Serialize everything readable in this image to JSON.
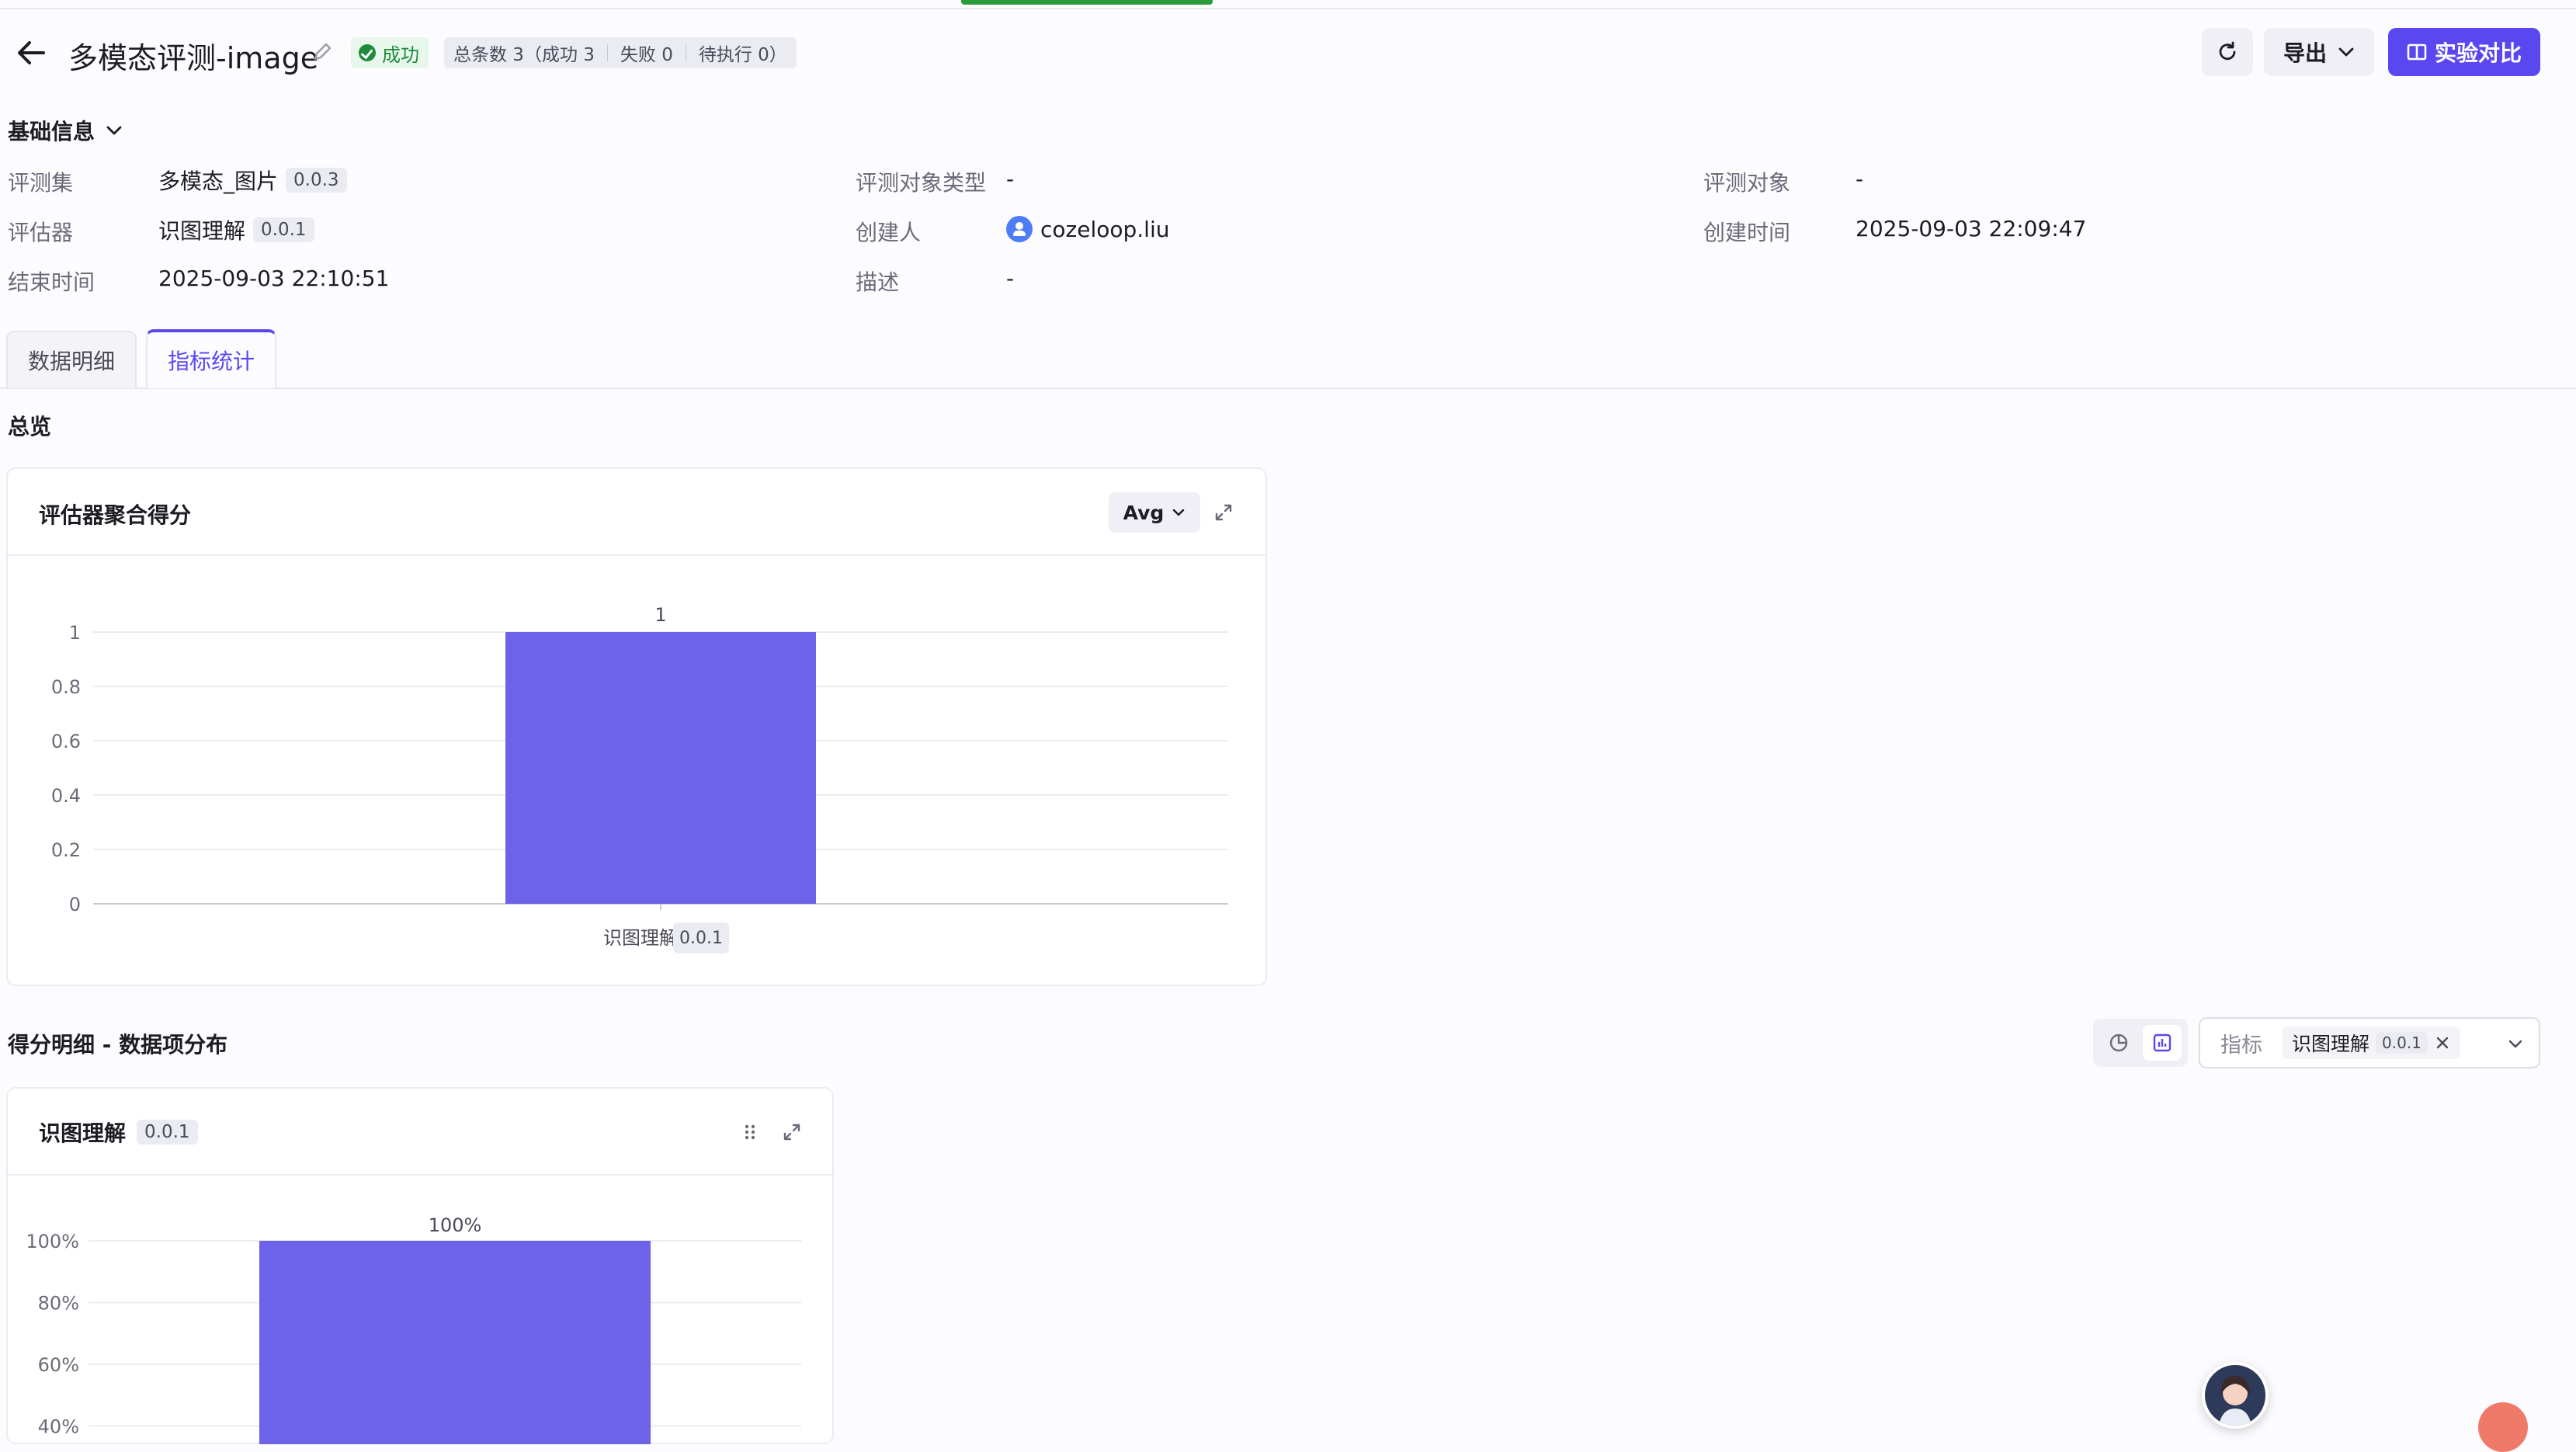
{
  "header": {
    "title": "多模态评测-image",
    "status": "成功",
    "counts": {
      "total": "总条数 3（成功 3",
      "failed": "失败 0",
      "pending": "待执行 0）"
    },
    "export_label": "导出",
    "compare_label": "实验对比"
  },
  "basic_info": {
    "title": "基础信息",
    "rows": {
      "dataset_label": "评测集",
      "dataset_value": "多模态_图片",
      "dataset_version": "0.0.3",
      "target_type_label": "评测对象类型",
      "target_type_value": "-",
      "target_label": "评测对象",
      "target_value": "-",
      "evaluator_label": "评估器",
      "evaluator_value": "识图理解",
      "evaluator_version": "0.0.1",
      "creator_label": "创建人",
      "creator_value": "cozeloop.liu",
      "created_label": "创建时间",
      "created_value": "2025-09-03 22:09:47",
      "ended_label": "结束时间",
      "ended_value": "2025-09-03 22:10:51",
      "desc_label": "描述",
      "desc_value": "-"
    }
  },
  "tabs": [
    {
      "label": "数据明细",
      "active": false
    },
    {
      "label": "指标统计",
      "active": true
    }
  ],
  "overview": {
    "title": "总览",
    "card_title": "评估器聚合得分",
    "aggregate_select": "Avg"
  },
  "distribution": {
    "title": "得分明细 - 数据项分布",
    "metric_placeholder": "指标",
    "metric_chip": "识图理解",
    "metric_chip_version": "0.0.1",
    "card_title": "识图理解",
    "card_version": "0.0.1"
  },
  "chart_data": [
    {
      "type": "bar",
      "categories": [
        "识图理解"
      ],
      "category_versions": [
        "0.0.1"
      ],
      "values": [
        1
      ],
      "data_labels": [
        "1"
      ],
      "yticks": [
        "0",
        "0.2",
        "0.4",
        "0.6",
        "0.8",
        "1"
      ],
      "ylim": [
        0,
        1
      ],
      "grid": true,
      "bar_color": "#6c63e8"
    },
    {
      "type": "bar",
      "values": [
        100
      ],
      "data_labels": [
        "100%"
      ],
      "yticks": [
        "40%",
        "60%",
        "80%",
        "100%"
      ],
      "ylim": [
        0,
        100
      ],
      "grid": true,
      "bar_color": "#6c63e8"
    }
  ],
  "colors": {
    "accent": "#5b47f0",
    "success": "#1e8a3a",
    "bar": "#6c63e8"
  },
  "icons": [
    "arrow-left-icon",
    "pencil-icon",
    "check-circle-icon",
    "refresh-icon",
    "chevron-down-icon",
    "compare-icon",
    "expand-icon",
    "drag-handle-icon",
    "pie-chart-icon",
    "bar-chart-icon",
    "close-icon",
    "user-icon"
  ]
}
